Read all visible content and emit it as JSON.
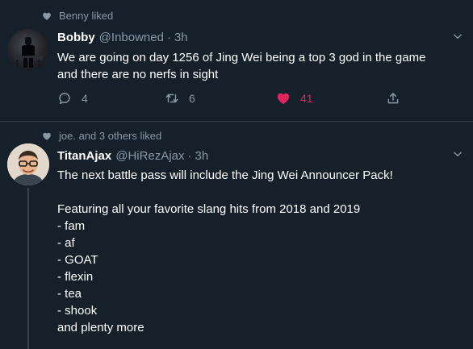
{
  "tweets": [
    {
      "social_context": "Benny liked",
      "name": "Bobby",
      "handle": "@Inbowned",
      "separator": "·",
      "time": "3h",
      "text": "We are going on day 1256 of Jing Wei being a top 3 god in the game\nand there are no nerfs in sight",
      "reply_count": "4",
      "retweet_count": "6",
      "like_count": "41"
    },
    {
      "social_context": "joe. and 3 others liked",
      "name": "TitanAjax",
      "handle": "@HiRezAjax",
      "separator": "·",
      "time": "3h",
      "text": "The next battle pass will include the Jing Wei Announcer Pack!\n\nFeaturing all your favorite slang hits from 2018 and 2019\n- fam\n- af\n- GOAT\n- flexin\n- tea\n- shook\nand plenty more"
    }
  ],
  "colors": {
    "background": "#15202b",
    "text": "#ffffff",
    "secondary": "#8899a6",
    "liked": "#e0245e",
    "divider": "#38444d"
  },
  "icons": [
    "heart-small-icon",
    "chevron-down-icon",
    "reply-icon",
    "retweet-icon",
    "heart-filled-icon",
    "share-icon"
  ]
}
